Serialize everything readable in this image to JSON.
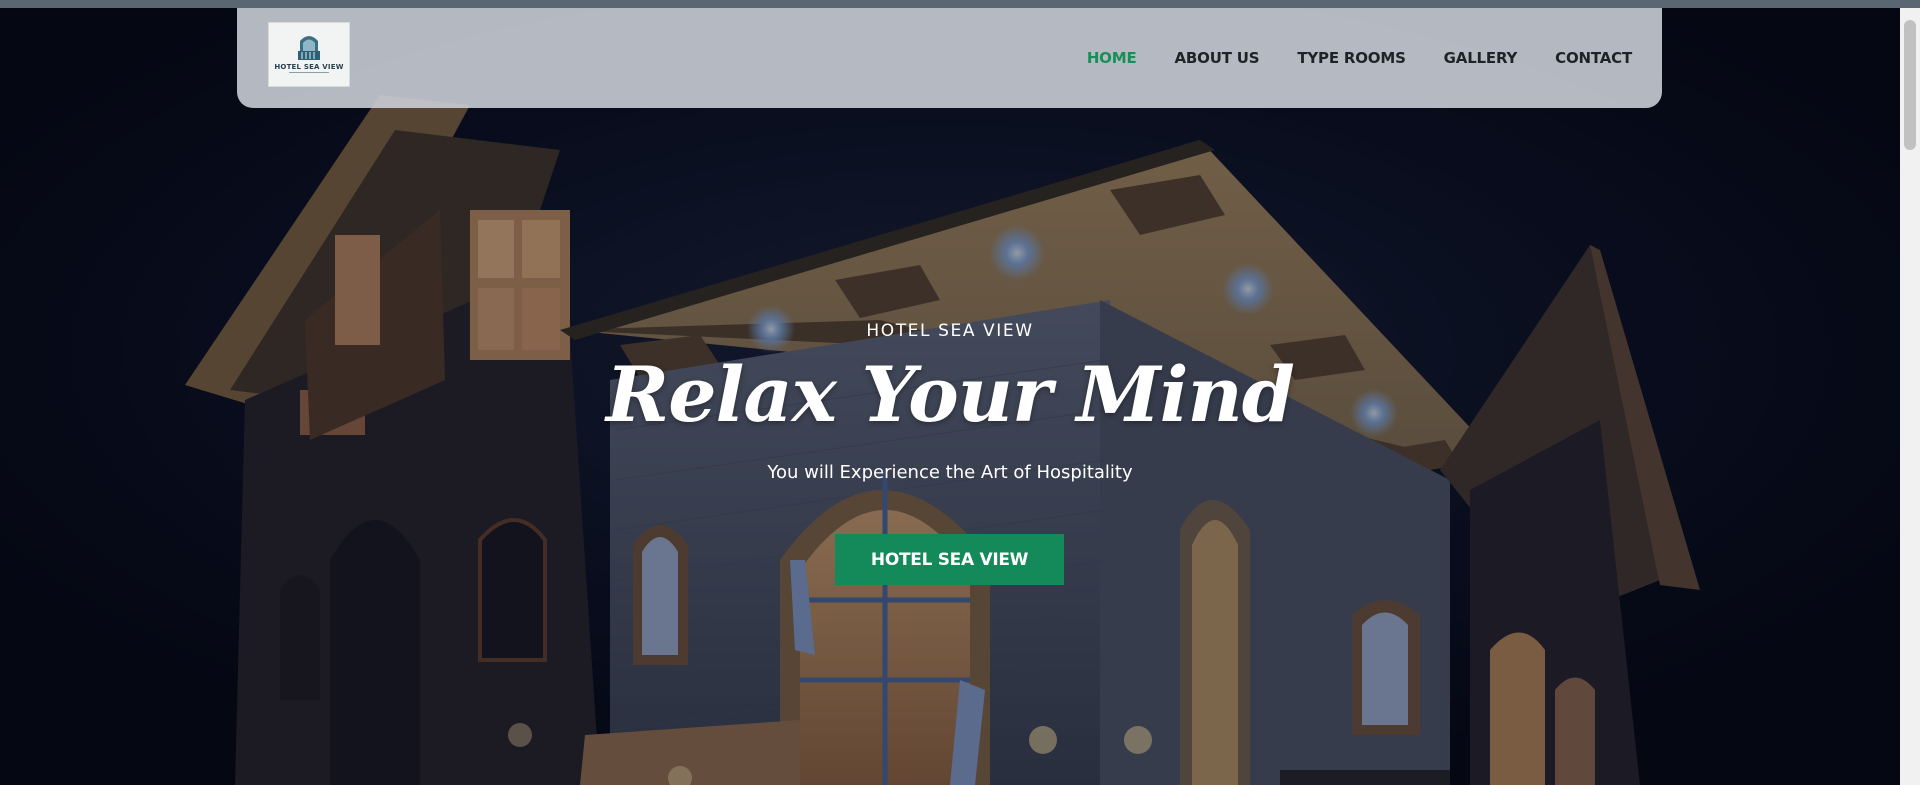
{
  "brand": {
    "logo_text": "HOTEL SEA VIEW",
    "logo_icon": "building-icon"
  },
  "nav": {
    "items": [
      {
        "label": "HOME",
        "active": true
      },
      {
        "label": "ABOUT US",
        "active": false
      },
      {
        "label": "TYPE ROOMS",
        "active": false
      },
      {
        "label": "GALLERY",
        "active": false
      },
      {
        "label": "CONTACT",
        "active": false
      }
    ]
  },
  "hero": {
    "eyebrow": "HOTEL SEA VIEW",
    "headline": "Relax Your Mind",
    "subtitle": "You will Experience the Art of Hospitality",
    "cta_label": "HOTEL SEA VIEW"
  },
  "colors": {
    "accent": "#14895a",
    "active_nav": "#179058",
    "nav_text": "#1e2326",
    "hero_overlay": "#070b1c"
  }
}
